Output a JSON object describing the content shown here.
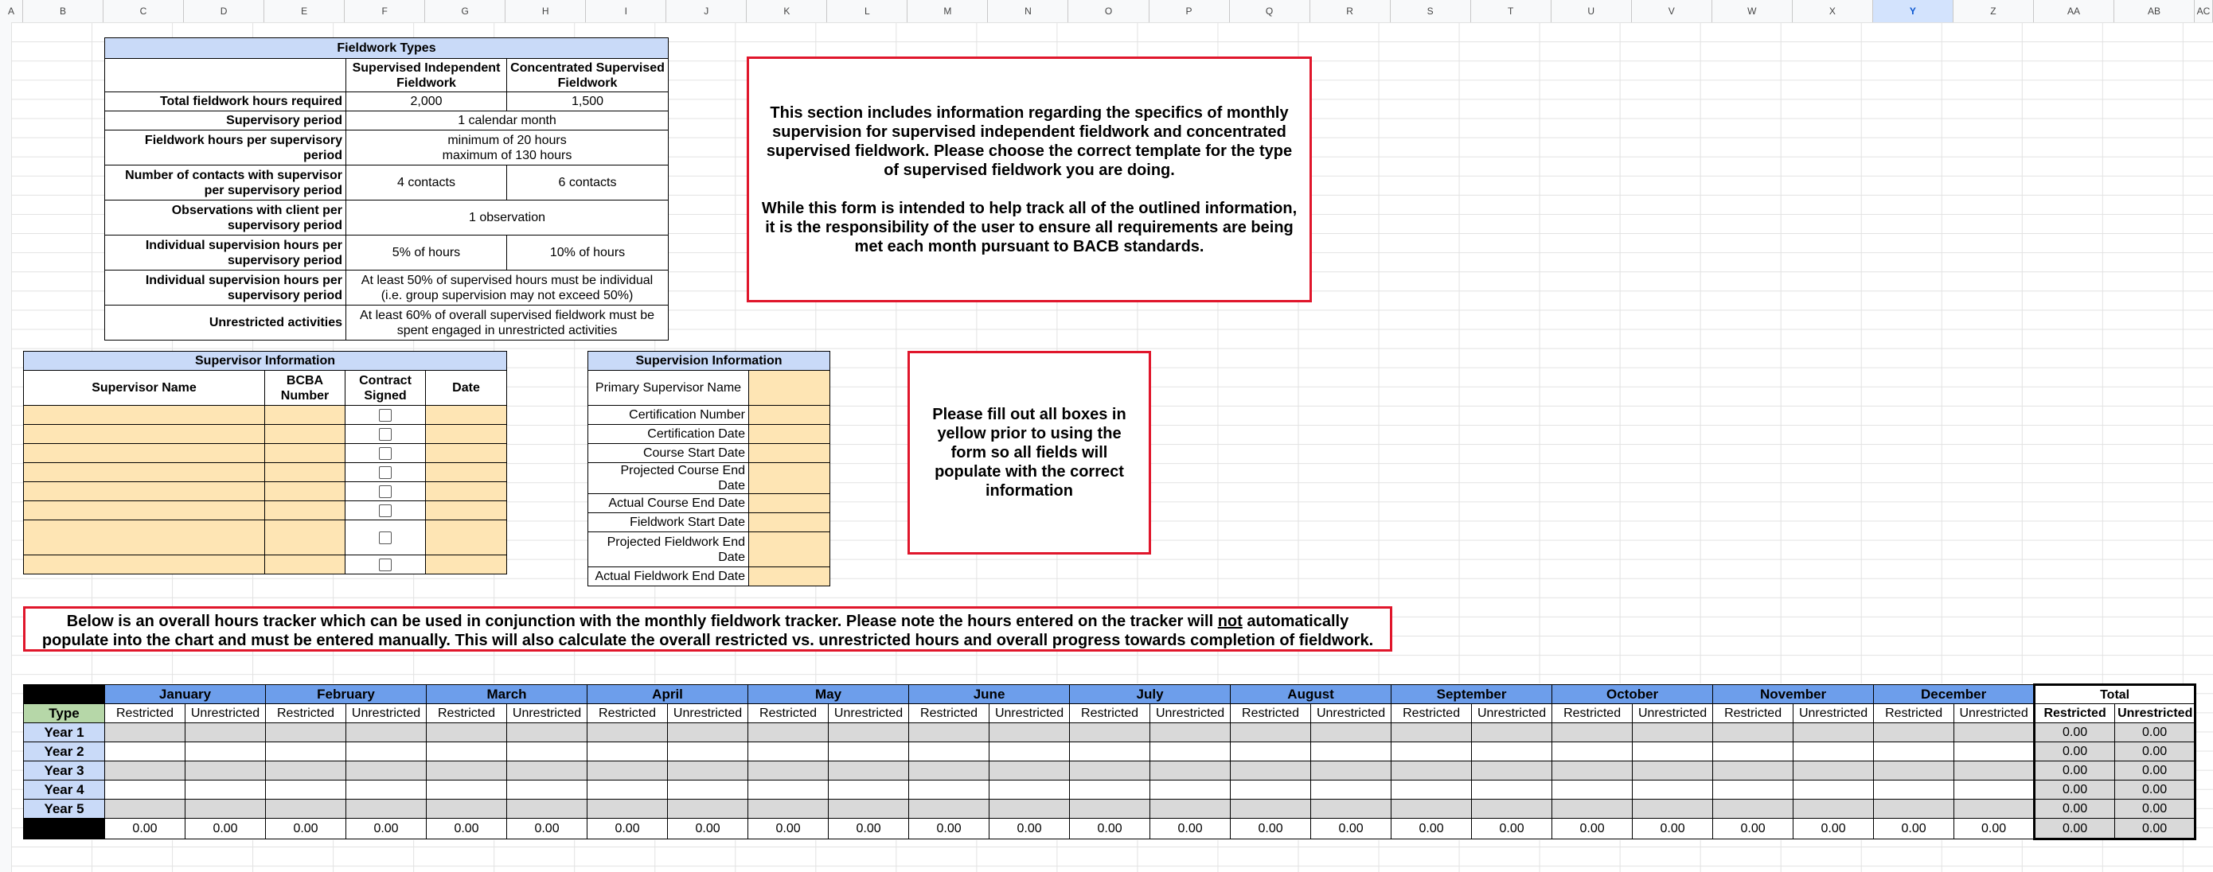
{
  "spreadsheet": {
    "column_headers": [
      "A",
      "B",
      "C",
      "D",
      "E",
      "F",
      "G",
      "H",
      "I",
      "J",
      "K",
      "L",
      "M",
      "N",
      "O",
      "P",
      "Q",
      "R",
      "S",
      "T",
      "U",
      "V",
      "W",
      "X",
      "Y",
      "Z",
      "AA",
      "AB",
      "AC"
    ],
    "selected_column": "Y"
  },
  "fieldwork_types": {
    "title": "Fieldwork Types",
    "col1": "Supervised Independent Fieldwork",
    "col2": "Concentrated Supervised Fieldwork",
    "rows": [
      {
        "label": "Total fieldwork hours required",
        "v1": "2,000",
        "v2": "1,500"
      },
      {
        "label": "Supervisory period",
        "merged": "1 calendar month"
      },
      {
        "label": "Fieldwork hours per supervisory period",
        "merged_line1": "minimum of 20 hours",
        "merged_line2": "maximum of 130 hours"
      },
      {
        "label": "Number of contacts with supervisor per supervisory period",
        "v1": "4 contacts",
        "v2": "6 contacts"
      },
      {
        "label": "Observations with client per supervisory period",
        "merged": "1 observation"
      },
      {
        "label": "Individual supervision hours per supervisory period",
        "v1": "5% of hours",
        "v2": "10% of hours"
      },
      {
        "label": "Individual supervision hours per supervisory period",
        "merged": "At least 50% of supervised hours must be individual (i.e. group supervision may not exceed 50%)"
      },
      {
        "label": "Unrestricted activities",
        "merged": "At least 60% of overall supervised fieldwork must be spent engaged in unrestricted activities"
      }
    ]
  },
  "note_top": {
    "para1": "This section includes information regarding the specifics of monthly supervision for supervised independent fieldwork and concentrated supervised fieldwork. Please choose the correct template for the type of supervised fieldwork you are doing.",
    "para2": "While this form is intended to help track all of the outlined information, it is the responsibility of the user to ensure all requirements are being met each month pursuant to BACB standards."
  },
  "supervisor_info": {
    "title": "Supervisor Information",
    "headers": [
      "Supervisor Name",
      "BCBA Number",
      "Contract Signed",
      "Date"
    ],
    "row_count": 8
  },
  "supervision_info": {
    "title": "Supervision Information",
    "fields": [
      "Primary Supervisor Name",
      "Certification Number",
      "Certification Date",
      "Course Start Date",
      "Projected Course End Date",
      "Actual Course End Date",
      "Fieldwork Start Date",
      "Projected Fieldwork End Date",
      "Actual Fieldwork End Date"
    ]
  },
  "note_yellow": "Please fill out all boxes in yellow prior to using the form so all fields will populate with the correct information",
  "banner": {
    "pre": "Below is an overall hours tracker which can be used in conjunction with the monthly fieldwork tracker. Please note the hours entered on the tracker will ",
    "underlined": "not",
    "post": " automatically populate into the chart and must be entered manually. This will also calculate the overall restricted vs. unrestricted hours and overall progress towards completion of fieldwork."
  },
  "tracker": {
    "months": [
      "January",
      "February",
      "March",
      "April",
      "May",
      "June",
      "July",
      "August",
      "September",
      "October",
      "November",
      "December"
    ],
    "total_label": "Total",
    "restricted": "Restricted",
    "unrestricted": "Unrestricted",
    "type_label": "Type",
    "years": [
      "Year 1",
      "Year 2",
      "Year 3",
      "Year 4",
      "Year 5"
    ],
    "zero": "0.00"
  }
}
